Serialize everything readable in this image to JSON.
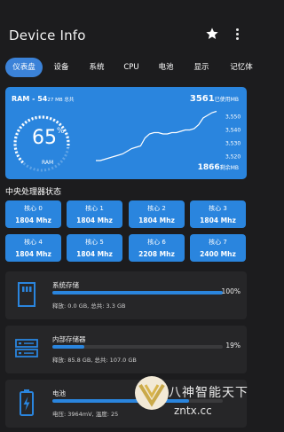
{
  "app": {
    "title": "Device Info",
    "star_icon": "star-icon",
    "more_icon": "more-vert-icon"
  },
  "tabs": [
    {
      "label": "仪表盘",
      "active": true
    },
    {
      "label": "设备"
    },
    {
      "label": "系统"
    },
    {
      "label": "CPU"
    },
    {
      "label": "电池"
    },
    {
      "label": "显示"
    },
    {
      "label": "记忆体"
    }
  ],
  "ram": {
    "label": "RAM - 54",
    "total_suffix": "27 MB 总共",
    "used_value": "3561",
    "used_suffix": "已使用MB",
    "free_value": "1866",
    "free_suffix": "剩余MB",
    "percent": "65",
    "percent_sign": "%",
    "gauge_label": "RAM",
    "gauge_fraction": 0.65,
    "colors": {
      "card": "#2a85de",
      "ring": "#ffffff"
    }
  },
  "chart_data": {
    "type": "line",
    "title": "",
    "xlabel": "",
    "ylabel": "",
    "ylim": [
      3515,
      3555
    ],
    "ytick_labels": [
      "3,550",
      "3,540",
      "3,530",
      "3,520"
    ],
    "yticks": [
      3550,
      3540,
      3530,
      3520
    ],
    "series": [
      {
        "values": [
          3517,
          3517,
          3518,
          3519,
          3520,
          3521,
          3522,
          3524,
          3526,
          3527,
          3528,
          3534,
          3537,
          3538,
          3538,
          3537,
          3537,
          3538,
          3538,
          3539,
          3540,
          3540,
          3541,
          3544,
          3549,
          3551,
          3553,
          3554
        ]
      }
    ]
  },
  "cpu": {
    "section_title": "中央处理器状态",
    "cores": [
      {
        "name": "核心 0",
        "freq": "1804 Mhz"
      },
      {
        "name": "核心 1",
        "freq": "1804 Mhz"
      },
      {
        "name": "核心 2",
        "freq": "1804 Mhz"
      },
      {
        "name": "核心 3",
        "freq": "1804 Mhz"
      },
      {
        "name": "核心 4",
        "freq": "1804 Mhz"
      },
      {
        "name": "核心 5",
        "freq": "1804 Mhz"
      },
      {
        "name": "核心 6",
        "freq": "2208 Mhz"
      },
      {
        "name": "核心 7",
        "freq": "2400 Mhz"
      }
    ]
  },
  "storage": [
    {
      "name": "系统存储",
      "percent": "100%",
      "fill": 1.0,
      "detail": "释放: 0.0 GB,  总共: 3.3 GB",
      "icon": "sd-card-icon"
    },
    {
      "name": "内部存储器",
      "percent": "19%",
      "fill": 0.19,
      "detail": "释放: 85.8 GB,  总共: 107.0 GB",
      "icon": "server-storage-icon"
    },
    {
      "name": "电池",
      "percent": "",
      "fill": 0.8,
      "detail": "电压: 3964mV,  温度: 25",
      "icon": "battery-charging-icon"
    }
  ],
  "watermark": {
    "text": "八神智能天下",
    "url": "zntx.cc"
  }
}
